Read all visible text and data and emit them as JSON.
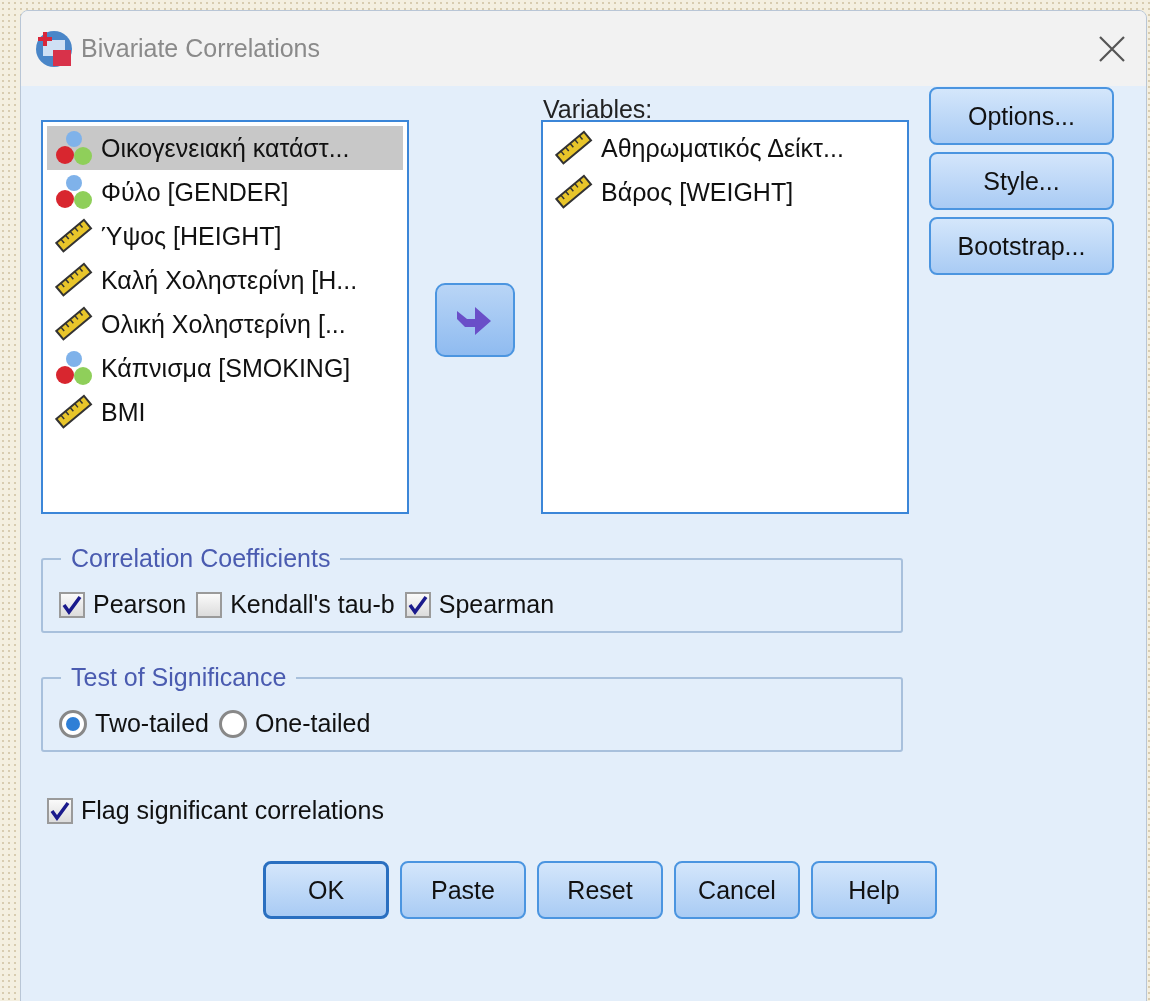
{
  "window": {
    "title": "Bivariate Correlations"
  },
  "source_list": {
    "items": [
      {
        "label": "Οικογενειακή κατάστ...",
        "kind": "nominal",
        "selected": true
      },
      {
        "label": "Φύλο  [GENDER]",
        "kind": "nominal",
        "selected": false
      },
      {
        "label": "Ύψος [HEIGHT]",
        "kind": "scale",
        "selected": false
      },
      {
        "label": "Καλή Χοληστερίνη [H...",
        "kind": "scale",
        "selected": false
      },
      {
        "label": "Ολική Χοληστερίνη [...",
        "kind": "scale",
        "selected": false
      },
      {
        "label": "Κάπνισμα [SMOKING]",
        "kind": "nominal",
        "selected": false
      },
      {
        "label": "BMI",
        "kind": "scale",
        "selected": false
      }
    ]
  },
  "variables": {
    "label": "Variables:",
    "items": [
      {
        "label": "Αθηρωματικός Δείκτ...",
        "kind": "scale",
        "selected": false
      },
      {
        "label": "Βάρος [WEIGHT]",
        "kind": "scale",
        "selected": false
      }
    ]
  },
  "side_buttons": [
    "Options...",
    "Style...",
    "Bootstrap..."
  ],
  "correlation_coefficients": {
    "title": "Correlation Coefficients",
    "options": [
      {
        "label": "Pearson",
        "checked": true
      },
      {
        "label": "Kendall's tau-b",
        "checked": false
      },
      {
        "label": "Spearman",
        "checked": true
      }
    ]
  },
  "test_of_significance": {
    "title": "Test of Significance",
    "options": [
      {
        "label": "Two-tailed",
        "selected": true
      },
      {
        "label": "One-tailed",
        "selected": false
      }
    ]
  },
  "flag": {
    "label": "Flag significant correlations",
    "checked": true
  },
  "buttons": [
    {
      "label": "OK",
      "default": true
    },
    {
      "label": "Paste",
      "default": false
    },
    {
      "label": "Reset",
      "default": false
    },
    {
      "label": "Cancel",
      "default": false
    },
    {
      "label": "Help",
      "default": false
    }
  ]
}
